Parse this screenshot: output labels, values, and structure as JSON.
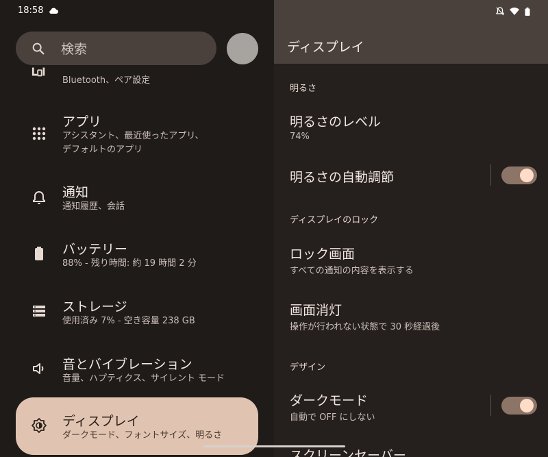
{
  "status": {
    "time": "18:58"
  },
  "search": {
    "placeholder": "検索"
  },
  "left_items": [
    {
      "title": "",
      "sub": "Bluetooth、ペア設定"
    },
    {
      "title": "アプリ",
      "sub1": "アシスタント、最近使ったアプリ、",
      "sub2": "デフォルトのアプリ"
    },
    {
      "title": "通知",
      "sub": "通知履歴、会話"
    },
    {
      "title": "バッテリー",
      "sub": "88% - 残り時間: 約 19 時間 2 分"
    },
    {
      "title": "ストレージ",
      "sub": "使用済み 7% - 空き容量 238 GB"
    },
    {
      "title": "音とバイブレーション",
      "sub": "音量、ハプティクス、サイレント モード"
    },
    {
      "title": "ディスプレイ",
      "sub": "ダークモード、フォントサイズ、明るさ"
    }
  ],
  "right": {
    "title": "ディスプレイ",
    "sec_brightness": "明るさ",
    "brightness_level": "明るさのレベル",
    "brightness_value": "74%",
    "auto_brightness": "明るさの自動調節",
    "sec_lock": "ディスプレイのロック",
    "lock_screen": "ロック画面",
    "lock_screen_sub": "すべての通知の内容を表示する",
    "screen_timeout": "画面消灯",
    "screen_timeout_sub": "操作が行われない状態で 30 秒経過後",
    "sec_design": "デザイン",
    "dark_mode": "ダークモード",
    "dark_mode_sub": "自動で OFF にしない",
    "screensaver": "スクリーンセーバー"
  },
  "toggles": {
    "auto_brightness": true,
    "dark_mode": true
  }
}
